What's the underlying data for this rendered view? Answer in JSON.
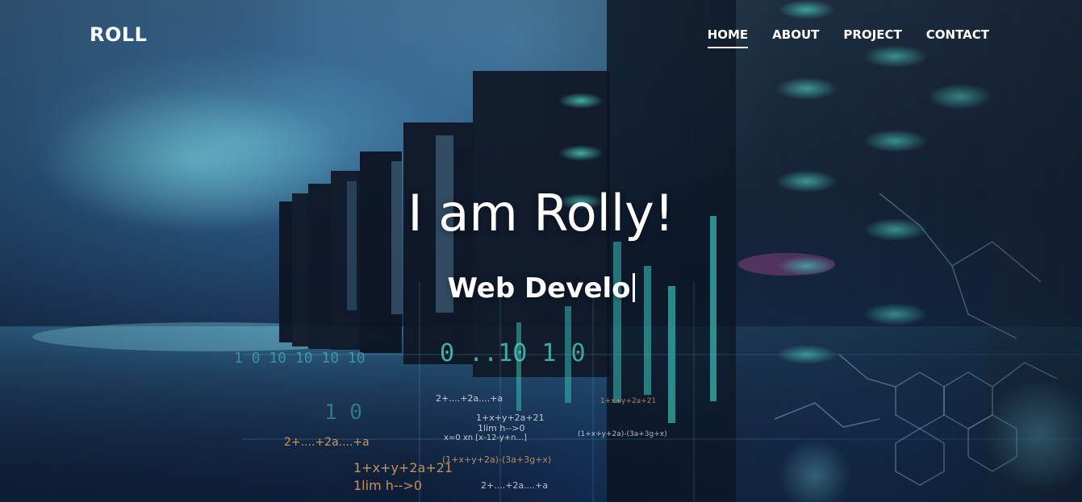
{
  "navbar": {
    "brand": "ROLL",
    "items": [
      {
        "label": "HOME",
        "active": true
      },
      {
        "label": "ABOUT",
        "active": false
      },
      {
        "label": "PROJECT",
        "active": false
      },
      {
        "label": "CONTACT",
        "active": false
      }
    ]
  },
  "hero": {
    "title": "I am Rolly!",
    "typed_text": "Web Develo",
    "background_image": "server room with data and formula overlay"
  },
  "colors": {
    "text": "#ffffff",
    "accent_cyan": "#44e6d8",
    "overlay_orange": "#f6b36b"
  },
  "icons": {
    "text_cursor": "text-cursor-icon"
  }
}
